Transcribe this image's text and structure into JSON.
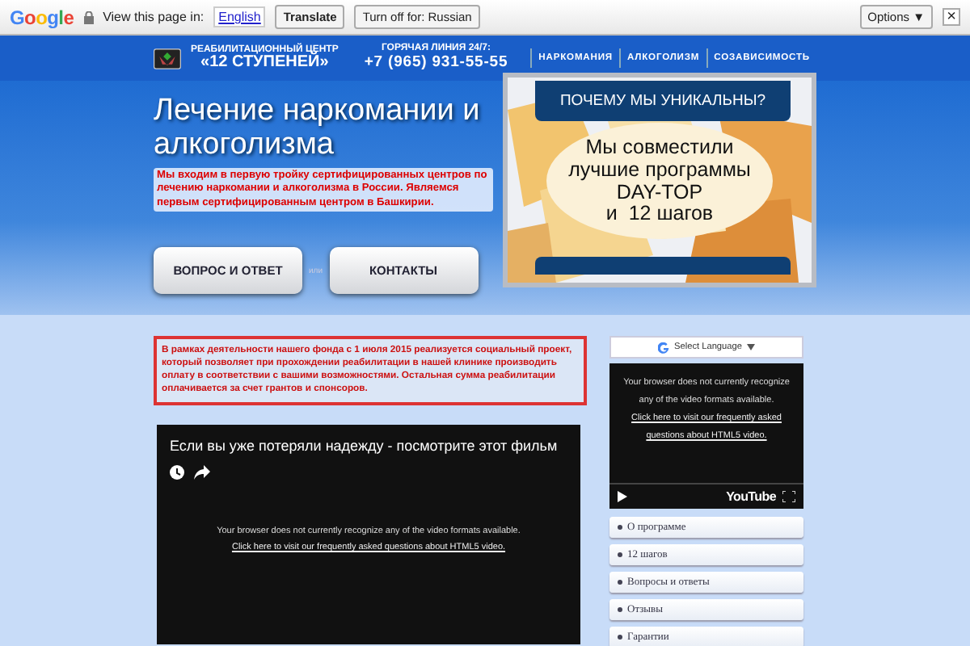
{
  "translate_bar": {
    "logo": "Google",
    "prompt": "View this page in:",
    "language": "English",
    "translate_button": "Translate",
    "turn_off_button": "Turn off for: Russian",
    "options_button": "Options ▼",
    "close": "×"
  },
  "header": {
    "org_line1": "РЕАБИЛИТАЦИОННЫЙ ЦЕНТР",
    "org_line2": "«12 СТУПЕНЕЙ»",
    "hotline_label": "ГОРЯЧАЯ ЛИНИЯ 24/7:",
    "phone": "+7 (965) 931-55-55",
    "nav": [
      "НАРКОМАНИЯ",
      "АЛКОГОЛИЗМ",
      "СОЗАВИСИМОСТЬ"
    ]
  },
  "hero": {
    "title": "Лечение наркомании и алкоголизма",
    "lead": "Мы входим в первую тройку сертифицированных центров по лечению наркомании и алкоголизма в России. Являемся первым сертифицированным центром в Башкирии.",
    "buttons": [
      "ВОПРОС И ОТВЕТ",
      "КОНТАКТЫ"
    ],
    "or": "или",
    "banner": {
      "heading": "ПОЧЕМУ МЫ УНИКАЛЬНЫ?",
      "text_lines": [
        "Мы совместили",
        "лучшие программы",
        "DAY-TOP",
        "и  12 шагов"
      ]
    }
  },
  "notice": "В рамках деятельности нашего фонда с 1 июля 2015 реализуется социальный проект, который позволяет при прохождении реабилитации в нашей клинике производить оплату в соответствии с вашими возможностями. Остальная сумма реабилитации оплачивается за счет грантов и спонсоров.",
  "video": {
    "title": "Если вы уже потеряли надежду - посмотрите этот фильм",
    "message": "Your browser does not currently recognize any of the video formats available.",
    "link": "Click here to visit our frequently asked questions about HTML5 video."
  },
  "sidebar": {
    "language_select": "Select Language",
    "video": {
      "message": "Your browser does not currently recognize any of the video formats available.",
      "link": "Click here to visit our frequently asked questions about HTML5 video.",
      "logo": "YouTube"
    },
    "menu": [
      "О программе",
      "12 шагов",
      "Вопросы и ответы",
      "Отзывы",
      "Гарантии"
    ]
  }
}
